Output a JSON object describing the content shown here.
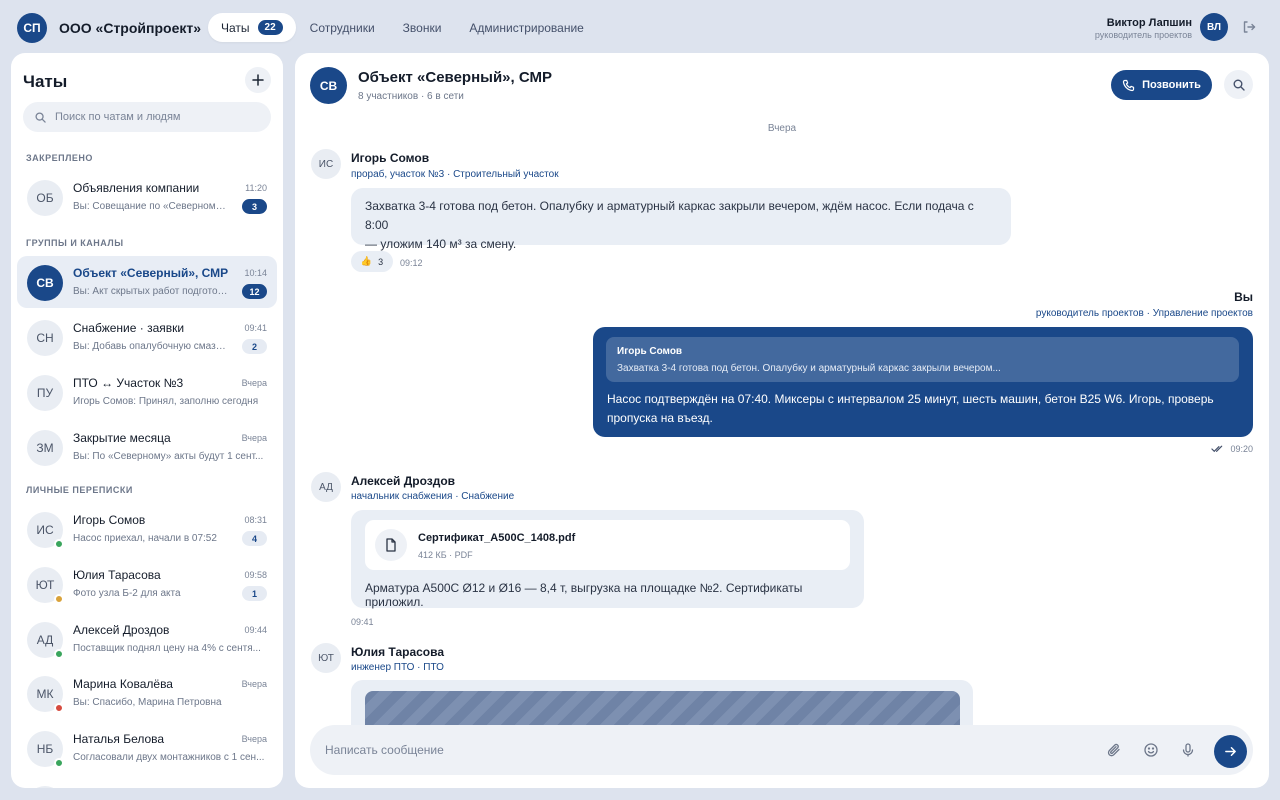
{
  "app": {
    "logo": "СП",
    "company": "ООО «Стройпроект»"
  },
  "nav": {
    "tabs": [
      {
        "label": "Чаты",
        "count": "22"
      },
      {
        "label": "Сотрудники"
      },
      {
        "label": "Звонки"
      },
      {
        "label": "Администрирование"
      }
    ]
  },
  "user": {
    "name": "Виктор Лапшин",
    "role": "руководитель проектов",
    "initials": "ВЛ"
  },
  "sidebar": {
    "title": "Чаты",
    "search_placeholder": "Поиск по чатам и людям",
    "sections": {
      "pinned": "ЗАКРЕПЛЕНО",
      "groups": "ГРУППЫ И КАНАЛЫ",
      "personal": "ЛИЧНЫЕ ПЕРЕПИСКИ"
    },
    "chats": [
      {
        "initials": "ОБ",
        "title": "Объявления компании",
        "time": "11:20",
        "preview": "Вы: Совещание по «Северному»...",
        "badge": "3"
      },
      {
        "initials": "СВ",
        "title": "Объект «Северный», СМР",
        "time": "10:14",
        "preview": "Вы: Акт скрытых работ подготов...",
        "badge": "12"
      },
      {
        "initials": "СН",
        "title": "Снабжение · заявки",
        "time": "09:41",
        "preview": "Вы: Добавь опалубочную смазк...",
        "badge": "2"
      },
      {
        "initials": "ПУ",
        "title": "ПТО ↔ Участок №3",
        "time": "Вчера",
        "preview": "Игорь Сомов: Принял, заполню сегодня"
      },
      {
        "initials": "ЗМ",
        "title": "Закрытие месяца",
        "time": "Вчера",
        "preview": "Вы: По «Северному» акты будут 1 сент..."
      },
      {
        "initials": "ИС",
        "title": "Игорь Сомов",
        "time": "08:31",
        "preview": "Насос приехал, начали в 07:52",
        "badge": "4",
        "status": "#3aa55d"
      },
      {
        "initials": "ЮТ",
        "title": "Юлия Тарасова",
        "time": "09:58",
        "preview": "Фото узла Б-2 для акта",
        "badge": "1",
        "status": "#d9a23a"
      },
      {
        "initials": "АД",
        "title": "Алексей Дроздов",
        "time": "09:44",
        "preview": "Поставщик поднял цену на 4% с сентя...",
        "status": "#3aa55d"
      },
      {
        "initials": "МК",
        "title": "Марина Ковалёва",
        "time": "Вчера",
        "preview": "Вы: Спасибо, Марина Петровна",
        "status": "#d64b3f"
      },
      {
        "initials": "НБ",
        "title": "Наталья Белова",
        "time": "Вчера",
        "preview": "Согласовали двух монтажников с 1 сен...",
        "status": "#3aa55d"
      }
    ]
  },
  "conversation": {
    "initials": "СВ",
    "title": "Объект «Северный», СМР",
    "subtitle": "8 участников · 6 в сети",
    "call_label": "Позвонить",
    "day_label": "Вчера",
    "messages": [
      {
        "initials": "ИС",
        "author": "Игорь Сомов",
        "role": "прораб, участок №3 · Строительный участок",
        "text_line1": "Захватка 3-4 готова под бетон. Опалубку и арматурный каркас закрыли вечером, ждём насос. Если подача с 8:00",
        "text_line2": "— уложим 140 м³ за смену.",
        "reaction_emoji": "👍",
        "reaction_count": "3",
        "time": "09:12"
      },
      {
        "author": "Вы",
        "role": "руководитель проектов · Управление проектов",
        "quote_author": "Игорь Сомов",
        "quote_text": "Захватка 3-4 готова под бетон. Опалубку и арматурный каркас закрыли вечером...",
        "text": "Насос подтверждён на 07:40. Миксеры с интервалом 25 минут, шесть машин, бетон В25 W6. Игорь, проверь пропуска на въезд.",
        "time": "09:20"
      },
      {
        "initials": "АД",
        "author": "Алексей Дроздов",
        "role": "начальник снабжения · Снабжение",
        "file_name": "Сертификат_А500С_1408.pdf",
        "file_meta": "412 КБ · PDF",
        "text": "Арматура А500С Ø12 и Ø16 — 8,4 т, выгрузка на площадке №2. Сертификаты приложил.",
        "time": "09:41"
      },
      {
        "initials": "ЮТ",
        "author": "Юлия Тарасова",
        "role": "инженер ПТО · ПТО"
      }
    ],
    "composer_placeholder": "Написать сообщение"
  },
  "colors": {
    "brand": "#1a4889",
    "online": "#3aa55d",
    "away": "#d9a23a",
    "busy": "#d64b3f",
    "background": "#dde3ee"
  },
  "icons": [
    "plus-icon",
    "search-icon",
    "logout-icon",
    "phone-icon",
    "file-icon",
    "attach-icon",
    "emoji-icon",
    "mic-icon",
    "send-icon",
    "double-check-icon"
  ]
}
